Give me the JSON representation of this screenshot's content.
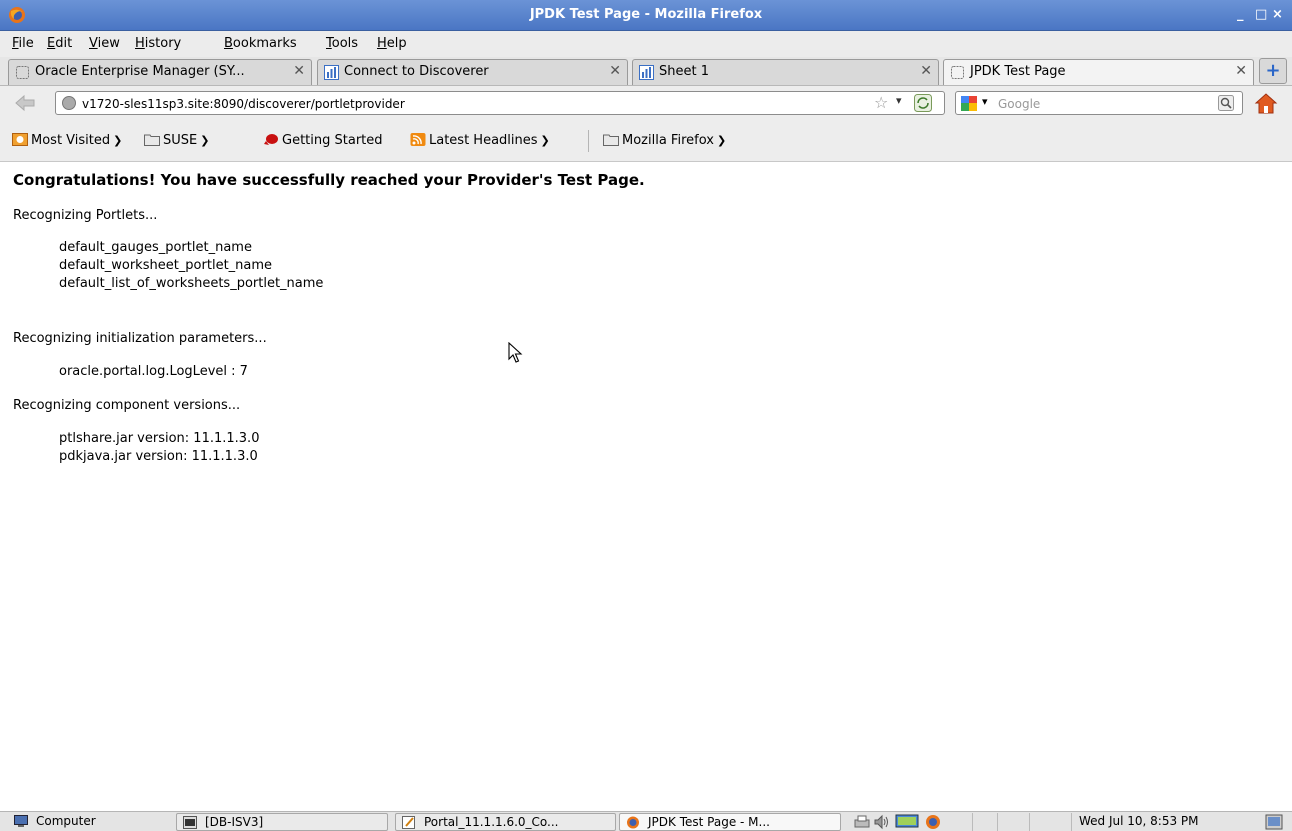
{
  "window": {
    "title": "JPDK Test Page - Mozilla Firefox"
  },
  "menu": [
    "File",
    "Edit",
    "View",
    "History",
    "Bookmarks",
    "Tools",
    "Help"
  ],
  "tabs": [
    {
      "label": "Oracle Enterprise Manager (SY...",
      "icon": "page-icon",
      "active": false
    },
    {
      "label": "Connect to Discoverer",
      "icon": "discoverer-icon",
      "active": false
    },
    {
      "label": "Sheet 1",
      "icon": "discoverer-icon",
      "active": false
    },
    {
      "label": "JPDK Test Page",
      "icon": "page-icon",
      "active": true
    }
  ],
  "nav": {
    "url": "v1720-sles11sp3.site:8090/discoverer/portletprovider",
    "search_placeholder": "Google"
  },
  "bookmarks": [
    {
      "label": "Most Visited",
      "icon": "most-visited-icon",
      "dropdown": true
    },
    {
      "label": "SUSE",
      "icon": "folder-icon",
      "dropdown": true
    },
    {
      "label": "Getting Started",
      "icon": "getting-started-icon",
      "dropdown": false
    },
    {
      "label": "Latest Headlines",
      "icon": "rss-icon",
      "dropdown": true
    },
    {
      "label": "Mozilla Firefox",
      "icon": "folder-icon",
      "dropdown": true
    }
  ],
  "content": {
    "heading": "Congratulations! You have successfully reached your Provider's Test Page.",
    "portlets_title": "Recognizing Portlets...",
    "portlets": [
      "default_gauges_portlet_name",
      "default_worksheet_portlet_name",
      "default_list_of_worksheets_portlet_name"
    ],
    "params_title": "Recognizing initialization parameters...",
    "params": [
      "oracle.portal.log.LogLevel : 7"
    ],
    "versions_title": "Recognizing component versions...",
    "versions": [
      "ptlshare.jar version: 11.1.1.3.0",
      "pdkjava.jar version: 11.1.1.3.0"
    ]
  },
  "taskbar": {
    "items": [
      {
        "label": "Computer",
        "icon": "computer-icon"
      },
      {
        "label": "[DB-ISV3]",
        "icon": "terminal-icon"
      },
      {
        "label": "Portal_11.1.1.6.0_Co...",
        "icon": "text-editor-icon"
      },
      {
        "label": "JPDK Test Page - M...",
        "icon": "firefox-icon"
      }
    ],
    "clock": "Wed Jul 10,  8:53 PM"
  },
  "colors": {
    "titlebar": "#4a76c4",
    "firefox_orange": "#e8741a",
    "link_blue": "#2b66c8"
  }
}
